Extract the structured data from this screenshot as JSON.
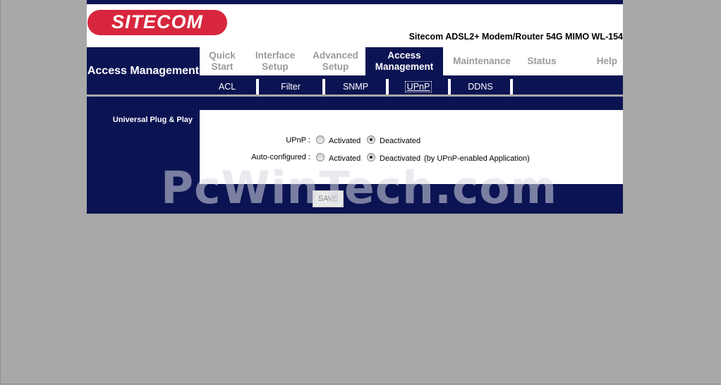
{
  "header": {
    "logo_text": "SITECOM",
    "model": "Sitecom ADSL2+ Modem/Router 54G MIMO WL-154"
  },
  "section_title": "Access Management",
  "main_nav": [
    {
      "label": "Quick Start",
      "active": false
    },
    {
      "label": "Interface Setup",
      "active": false
    },
    {
      "label": "Advanced Setup",
      "active": false
    },
    {
      "label": "Access Management",
      "active": true
    },
    {
      "label": "Maintenance",
      "active": false
    },
    {
      "label": "Status",
      "active": false
    },
    {
      "label": "Help",
      "active": false
    }
  ],
  "sub_nav": [
    {
      "label": "ACL",
      "active": false
    },
    {
      "label": "Filter",
      "active": false
    },
    {
      "label": "SNMP",
      "active": false
    },
    {
      "label": "UPnP",
      "active": true
    },
    {
      "label": "DDNS",
      "active": false
    }
  ],
  "side_label": "Universal Plug & Play",
  "form": {
    "upnp": {
      "label": "UPnP :",
      "options": [
        "Activated",
        "Deactivated"
      ],
      "selected": "Deactivated"
    },
    "auto_configured": {
      "label": "Auto-configured :",
      "options": [
        "Activated",
        "Deactivated"
      ],
      "selected": "Deactivated",
      "note": "(by UPnP-enabled Application)"
    }
  },
  "save_label": "SAVE",
  "watermark": "PcWinTech.com",
  "colors": {
    "navy": "#0b1352",
    "brand_red": "#d7263d",
    "background": "#a8a8a8"
  }
}
